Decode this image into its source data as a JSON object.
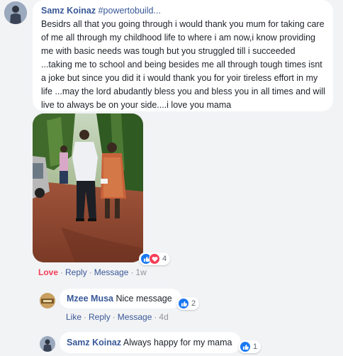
{
  "post_comment": {
    "author": "Samz Koinaz",
    "tag": "#powertobuild...",
    "text": "Besidrs all that you going through i would thank you mum for taking care of me all through my childhood life to where i am now,i know providing me with basic needs was tough but you struggled till i succeeded ...taking me to school and being besides me all through tough times isnt a joke but since you did it i would thank you for yoir tireless effort in my life ...may the lord abudantly bless you and bless you in all times and will live to always be on your side....i love you mama",
    "reaction_count": "4",
    "actions": {
      "love": "Love",
      "reply": "Reply",
      "message": "Message",
      "time": "1w"
    }
  },
  "replies": [
    {
      "author": "Mzee Musa",
      "text": "Nice message",
      "reaction_count": "2",
      "actions": {
        "like": "Like",
        "reply": "Reply",
        "message": "Message",
        "time": "4d"
      }
    },
    {
      "author": "Samz Koinaz",
      "text": "Always happy for my mama",
      "reaction_count": "1"
    }
  ],
  "colors": {
    "link": "#385898",
    "love": "#f33e58",
    "like": "#1877f2",
    "background": "#f2f3f5"
  },
  "icons": [
    "avatar",
    "like-reaction-icon",
    "love-reaction-icon"
  ]
}
